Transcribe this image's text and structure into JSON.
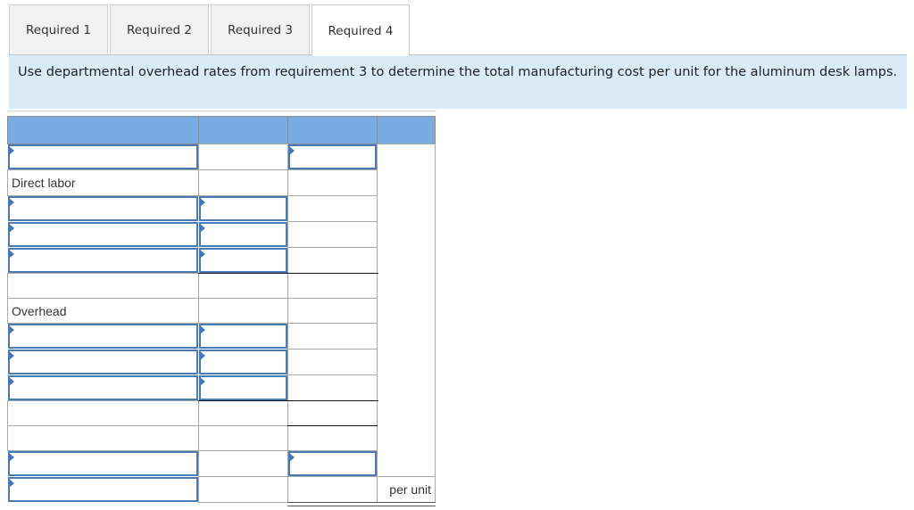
{
  "tabs": [
    {
      "label": "Required 1",
      "active": false
    },
    {
      "label": "Required 2",
      "active": false
    },
    {
      "label": "Required 3",
      "active": false
    },
    {
      "label": "Required 4",
      "active": true
    }
  ],
  "instruction": "Use departmental overhead rates from requirement 3 to determine the total manufacturing cost per unit for the aluminum desk lamps.",
  "table": {
    "header": [
      "",
      "",
      "",
      ""
    ],
    "rows": [
      {
        "label": "",
        "label_input": true,
        "col2_input": false,
        "col3_input": true,
        "col4": ""
      },
      {
        "label": "Direct labor",
        "label_input": false,
        "col2_input": false,
        "col3_input": false,
        "col4": ""
      },
      {
        "label": "",
        "label_input": true,
        "col2_input": true,
        "col3_input": false,
        "col4": ""
      },
      {
        "label": "",
        "label_input": true,
        "col2_input": true,
        "col3_input": false,
        "col4": ""
      },
      {
        "label": "",
        "label_input": true,
        "col2_input": true,
        "col3_input": false,
        "col4": ""
      },
      {
        "label": "",
        "label_input": false,
        "col2_input": false,
        "col3_input": false,
        "col4": ""
      },
      {
        "label": "Overhead",
        "label_input": false,
        "col2_input": false,
        "col3_input": false,
        "col4": ""
      },
      {
        "label": "",
        "label_input": true,
        "col2_input": true,
        "col3_input": false,
        "col4": ""
      },
      {
        "label": "",
        "label_input": true,
        "col2_input": true,
        "col3_input": false,
        "col4": ""
      },
      {
        "label": "",
        "label_input": true,
        "col2_input": true,
        "col3_input": false,
        "col4": ""
      },
      {
        "label": "",
        "label_input": false,
        "col2_input": false,
        "col3_input": false,
        "col4": ""
      },
      {
        "label": "",
        "label_input": false,
        "col2_input": false,
        "col3_input": false,
        "col4": ""
      },
      {
        "label": "",
        "label_input": true,
        "col2_input": false,
        "col3_input": true,
        "col4": ""
      },
      {
        "label": "",
        "label_input": true,
        "col2_input": false,
        "col3_input": false,
        "col4": "per unit"
      }
    ],
    "per_unit_label": "per unit"
  }
}
